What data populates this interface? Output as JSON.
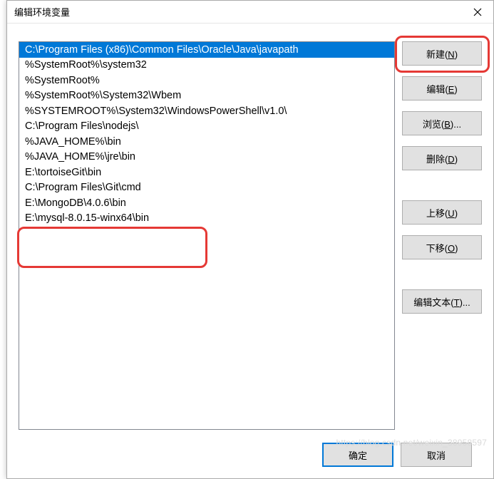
{
  "title": "编辑环境变量",
  "list": [
    "C:\\Program Files (x86)\\Common Files\\Oracle\\Java\\javapath",
    "%SystemRoot%\\system32",
    "%SystemRoot%",
    "%SystemRoot%\\System32\\Wbem",
    "%SYSTEMROOT%\\System32\\WindowsPowerShell\\v1.0\\",
    "C:\\Program Files\\nodejs\\",
    "%JAVA_HOME%\\bin",
    "%JAVA_HOME%\\jre\\bin",
    "E:\\tortoiseGit\\bin",
    "C:\\Program Files\\Git\\cmd",
    "E:\\MongoDB\\4.0.6\\bin",
    "E:\\mysql-8.0.15-winx64\\bin"
  ],
  "selected_index": 0,
  "buttons": {
    "new": {
      "pre": "新建(",
      "u": "N",
      "post": ")"
    },
    "edit": {
      "pre": "编辑(",
      "u": "E",
      "post": ")"
    },
    "browse": {
      "pre": "浏览(",
      "u": "B",
      "post": ")..."
    },
    "delete": {
      "pre": "删除(",
      "u": "D",
      "post": ")"
    },
    "move_up": {
      "pre": "上移(",
      "u": "U",
      "post": ")"
    },
    "move_down": {
      "pre": "下移(",
      "u": "O",
      "post": ")"
    },
    "edit_text": {
      "pre": "编辑文本(",
      "u": "T",
      "post": ")..."
    }
  },
  "bottom": {
    "ok": "确定",
    "cancel": "取消"
  },
  "watermark": "https://blog.csdn.net/weixin_38958597"
}
